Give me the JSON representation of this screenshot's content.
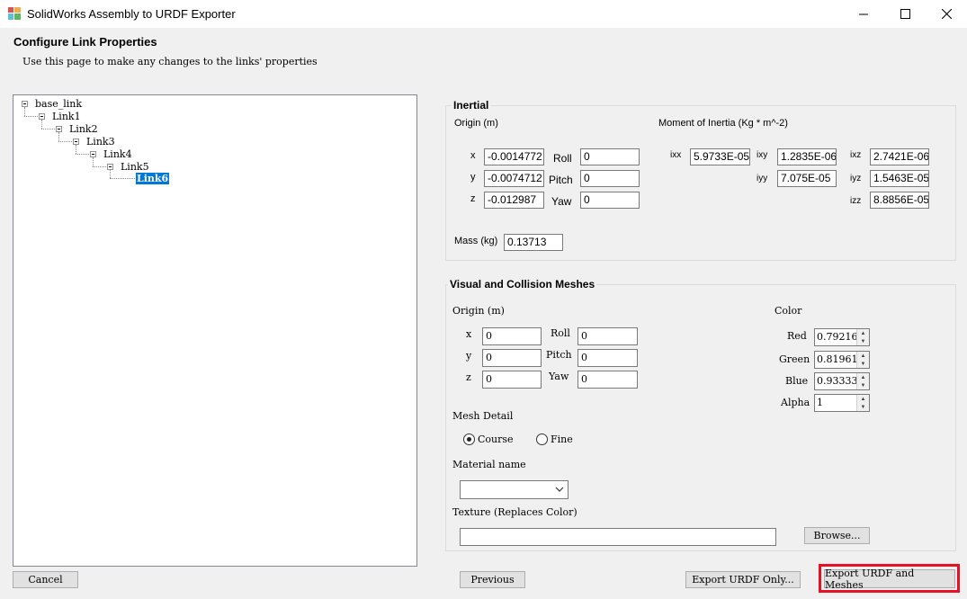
{
  "window": {
    "title": "SolidWorks Assembly to URDF Exporter"
  },
  "header": {
    "title": "Configure Link Properties",
    "subtitle": "Use this page to make any changes to the links' properties"
  },
  "tree": {
    "items": [
      {
        "label": "base_link"
      },
      {
        "label": "Link1"
      },
      {
        "label": "Link2"
      },
      {
        "label": "Link3"
      },
      {
        "label": "Link4"
      },
      {
        "label": "Link5"
      },
      {
        "label": "Link6"
      }
    ],
    "selected": "Link6"
  },
  "inertial": {
    "title": "Inertial",
    "origin_label": "Origin (m)",
    "moi_label": "Moment of Inertia (Kg * m^-2)",
    "x_label": "x",
    "y_label": "y",
    "z_label": "z",
    "x": "-0.0014772",
    "y": "-0.0074712",
    "z": "-0.012987",
    "roll_label": "Roll",
    "pitch_label": "Pitch",
    "yaw_label": "Yaw",
    "roll": "0",
    "pitch": "0",
    "yaw": "0",
    "ixx_label": "ixx",
    "ixy_label": "ixy",
    "ixz_label": "ixz",
    "iyy_label": "iyy",
    "iyz_label": "iyz",
    "izz_label": "izz",
    "ixx": "5.9733E-05",
    "ixy": "1.2835E-06",
    "ixz": "2.7421E-06",
    "iyy": "7.075E-05",
    "iyz": "1.5463E-05",
    "izz": "8.8856E-05",
    "mass_label": "Mass (kg)",
    "mass": "0.13713"
  },
  "visual": {
    "title": "Visual and Collision Meshes",
    "origin_label": "Origin (m)",
    "x_label": "x",
    "y_label": "y",
    "z_label": "z",
    "x": "0",
    "y": "0",
    "z": "0",
    "roll_label": "Roll",
    "pitch_label": "Pitch",
    "yaw_label": "Yaw",
    "roll": "0",
    "pitch": "0",
    "yaw": "0",
    "color_label": "Color",
    "red_label": "Red",
    "green_label": "Green",
    "blue_label": "Blue",
    "alpha_label": "Alpha",
    "red": "0.79216",
    "green": "0.81961",
    "blue": "0.93333",
    "alpha": "1",
    "mesh_detail_label": "Mesh Detail",
    "course_label": "Course",
    "fine_label": "Fine",
    "mesh_detail_selected": "Course",
    "material_label": "Material name",
    "material_value": "",
    "texture_label": "Texture (Replaces Color)",
    "texture_value": "",
    "browse_label": "Browse..."
  },
  "buttons": {
    "cancel": "Cancel",
    "previous": "Previous",
    "export_urdf_only": "Export URDF Only...",
    "export_urdf_meshes": "Export URDF  and Meshes"
  },
  "highlight_color": "#e81123",
  "selection_color": "#0078d7"
}
